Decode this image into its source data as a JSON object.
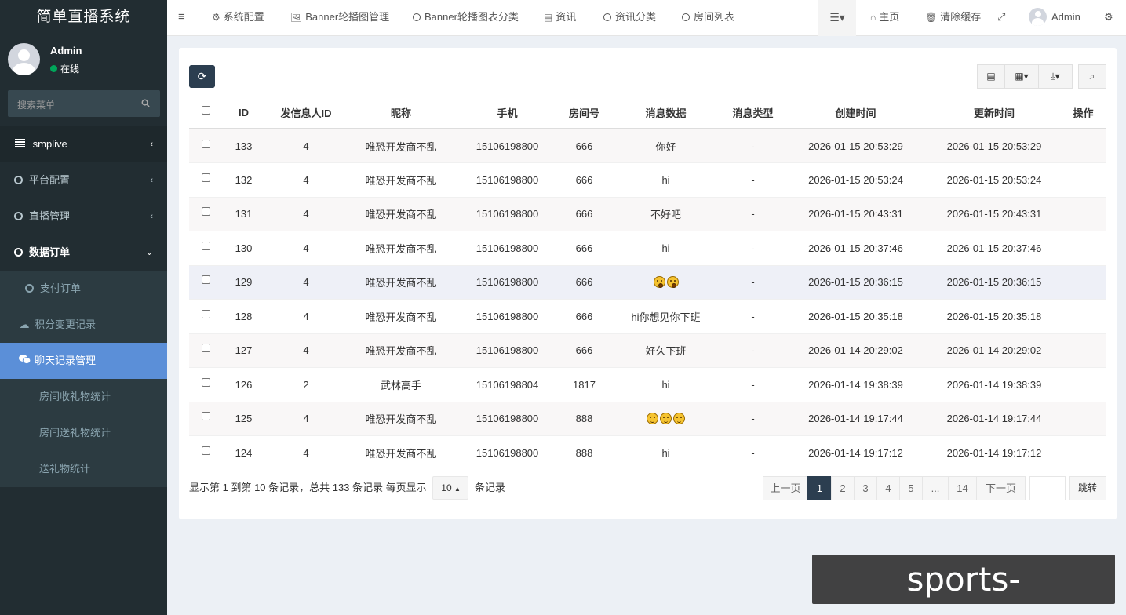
{
  "sidebar": {
    "app_title": "简单直播系统",
    "user": {
      "name": "Admin",
      "status": "在线"
    },
    "search_placeholder": "搜索菜单",
    "menu": [
      {
        "label": "smplive",
        "icon": "list-icon"
      },
      {
        "label": "平台配置"
      },
      {
        "label": "直播管理"
      },
      {
        "label": "数据订单"
      }
    ],
    "submenu": [
      {
        "label": "支付订单",
        "icon": "circle-icon"
      },
      {
        "label": "积分变更记录",
        "icon": "cloud-icon"
      },
      {
        "label": "聊天记录管理",
        "icon": "wechat-icon",
        "active": true
      },
      {
        "label": "房间收礼物统计",
        "icon": "none"
      },
      {
        "label": "房间送礼物统计",
        "icon": "none"
      },
      {
        "label": "送礼物统计",
        "icon": "none"
      }
    ]
  },
  "topnav": {
    "tabs": [
      "系统配置",
      "Banner轮播图管理",
      "Banner轮播图表分类",
      "资讯",
      "资讯分类",
      "房间列表"
    ],
    "home": "主页",
    "clear_cache": "清除缓存",
    "user": "Admin"
  },
  "table": {
    "headers": [
      "ID",
      "发信息人ID",
      "昵称",
      "手机",
      "房间号",
      "消息数据",
      "消息类型",
      "创建时间",
      "更新时间",
      "操作"
    ],
    "rows": [
      [
        "133",
        "4",
        "唯恐开发商不乱",
        "15106198800",
        "666",
        "你好",
        "-",
        "2026-01-15 20:53:29",
        "2026-01-15 20:53:29"
      ],
      [
        "132",
        "4",
        "唯恐开发商不乱",
        "15106198800",
        "666",
        "hi",
        "-",
        "2026-01-15 20:53:24",
        "2026-01-15 20:53:24"
      ],
      [
        "131",
        "4",
        "唯恐开发商不乱",
        "15106198800",
        "666",
        "不好吧",
        "-",
        "2026-01-15 20:43:31",
        "2026-01-15 20:43:31"
      ],
      [
        "130",
        "4",
        "唯恐开发商不乱",
        "15106198800",
        "666",
        "hi",
        "-",
        "2026-01-15 20:37:46",
        "2026-01-15 20:37:46"
      ],
      [
        "129",
        "4",
        "唯恐开发商不乱",
        "15106198800",
        "666",
        "",
        "-",
        "2026-01-15 20:36:15",
        "2026-01-15 20:36:15"
      ],
      [
        "128",
        "4",
        "唯恐开发商不乱",
        "15106198800",
        "666",
        "hi你想见你下班",
        "-",
        "2026-01-15 20:35:18",
        "2026-01-15 20:35:18"
      ],
      [
        "127",
        "4",
        "唯恐开发商不乱",
        "15106198800",
        "666",
        "好久下班",
        "-",
        "2026-01-14 20:29:02",
        "2026-01-14 20:29:02"
      ],
      [
        "126",
        "2",
        "武林高手",
        "15106198804",
        "1817",
        "hi",
        "-",
        "2026-01-14 19:38:39",
        "2026-01-14 19:38:39"
      ],
      [
        "125",
        "4",
        "唯恐开发商不乱",
        "15106198800",
        "888",
        "",
        "-",
        "2026-01-14 19:17:44",
        "2026-01-14 19:17:44"
      ],
      [
        "124",
        "4",
        "唯恐开发商不乱",
        "15106198800",
        "888",
        "hi",
        "-",
        "2026-01-14 19:17:12",
        "2026-01-14 19:17:12"
      ]
    ],
    "emoji_rows": {
      "129": [
        "wow",
        "wow"
      ],
      "125": [
        "grin",
        "grin",
        "grin"
      ]
    }
  },
  "pager": {
    "info_prefix": "显示第 1 到第 10 条记录，总共 133 条记录 每页显示",
    "page_size": "10",
    "info_suffix": "条记录",
    "prev": "上一页",
    "pages": [
      "1",
      "2",
      "3",
      "4",
      "5",
      "...",
      "14"
    ],
    "current": "1",
    "next": "下一页",
    "go": "跳转"
  },
  "watermark": "sports-wjty.com.cn"
}
